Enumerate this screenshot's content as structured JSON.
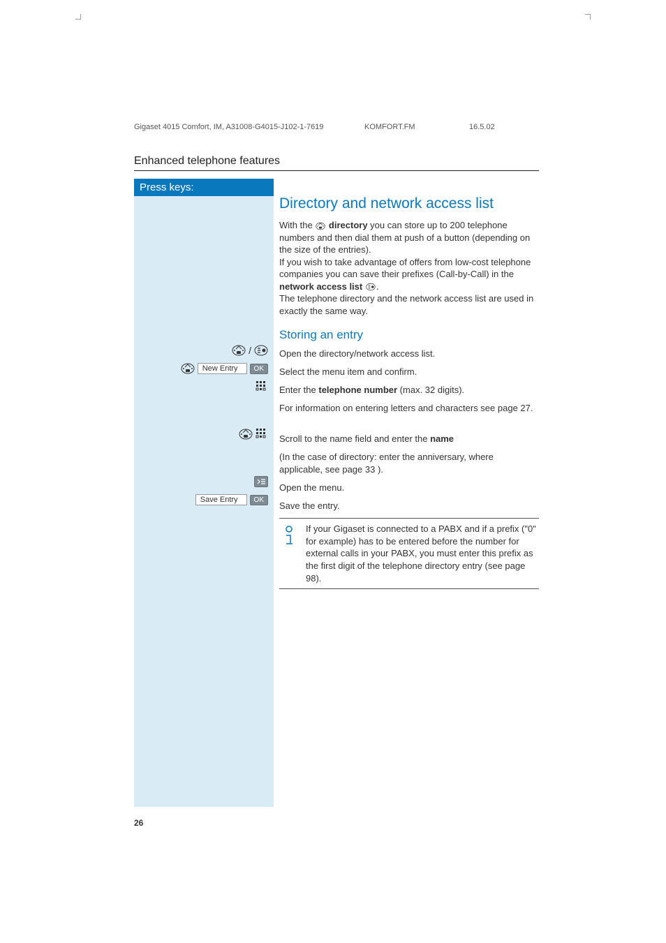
{
  "header": {
    "doc": "Gigaset 4015 Comfort, IM, A31008-G4015-J102-1-7619",
    "file": "KOMFORT.FM",
    "date": "16.5.02"
  },
  "section_title": "Enhanced telephone features",
  "left": {
    "press_keys": "Press keys:",
    "new_entry": "New Entry",
    "save_entry": "Save Entry",
    "ok": "OK",
    "slash": "/"
  },
  "content": {
    "h1": "Directory and network access list",
    "intro_a": "With the ",
    "intro_dir": "directory",
    "intro_b": " you can store up to 200 telephone numbers and then dial them at push of a button (depending on the size of the entries).",
    "intro_c": "If you wish to take advantage of offers from low-cost telephone companies you can save their prefixes (Call-by-Call) in the ",
    "intro_nal": "network access list",
    "intro_d": ".",
    "intro_e": "The telephone directory and the network access list are used in exactly the same way.",
    "h2": "Storing an entry",
    "s1": "Open the directory/network access list.",
    "s2": "Select the menu item and confirm.",
    "s3a": "Enter the ",
    "s3b": "telephone number",
    "s3c": " (max. 32 digits).",
    "s4": "For information on entering letters and characters see page 27.",
    "s5a": "Scroll to the name field and enter the ",
    "s5b": "name",
    "s6": "(In the case of directory: enter the anniversary, where applicable, see page 33 ).",
    "s7": "Open the menu.",
    "s8": "Save the entry.",
    "info": "If your Gigaset is connected to a PABX and if a prefix (\"0\" for example) has to be entered before the number for external calls in your PABX, you must enter this prefix as the first digit of the telephone directory entry (see page 98)."
  },
  "page_number": "26"
}
